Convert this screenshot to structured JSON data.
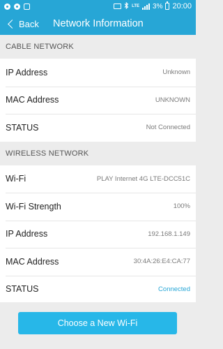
{
  "status_bar": {
    "lte": "LTE",
    "battery": "3%",
    "time": "20:00",
    "icons": [
      "notification-icon",
      "notification-icon",
      "notification-icon",
      "cast-icon",
      "bluetooth-icon",
      "signal-icon",
      "battery-icon"
    ]
  },
  "header": {
    "back_label": "Back",
    "title": "Network Information"
  },
  "cable_network": {
    "heading": "CABLE NETWORK",
    "rows": [
      {
        "label": "IP Address",
        "value": "Unknown"
      },
      {
        "label": "MAC Address",
        "value": "UNKNOWN"
      },
      {
        "label": "STATUS",
        "value": "Not Connected"
      }
    ]
  },
  "wireless_network": {
    "heading": "WIRELESS NETWORK",
    "rows": [
      {
        "label": "Wi-Fi",
        "value": "PLAY Internet 4G LTE-DCC51C"
      },
      {
        "label": "Wi-Fi Strength",
        "value": "100%"
      },
      {
        "label": "IP Address",
        "value": "192.168.1.149"
      },
      {
        "label": "MAC Address",
        "value": "30:4A:26:E4:CA:77"
      },
      {
        "label": "STATUS",
        "value": "Connected"
      }
    ]
  },
  "action": {
    "label": "Choose a New Wi-Fi"
  },
  "colors": {
    "accent": "#27a6d6",
    "button": "#27b7e8",
    "connected": "#27a6d6"
  }
}
